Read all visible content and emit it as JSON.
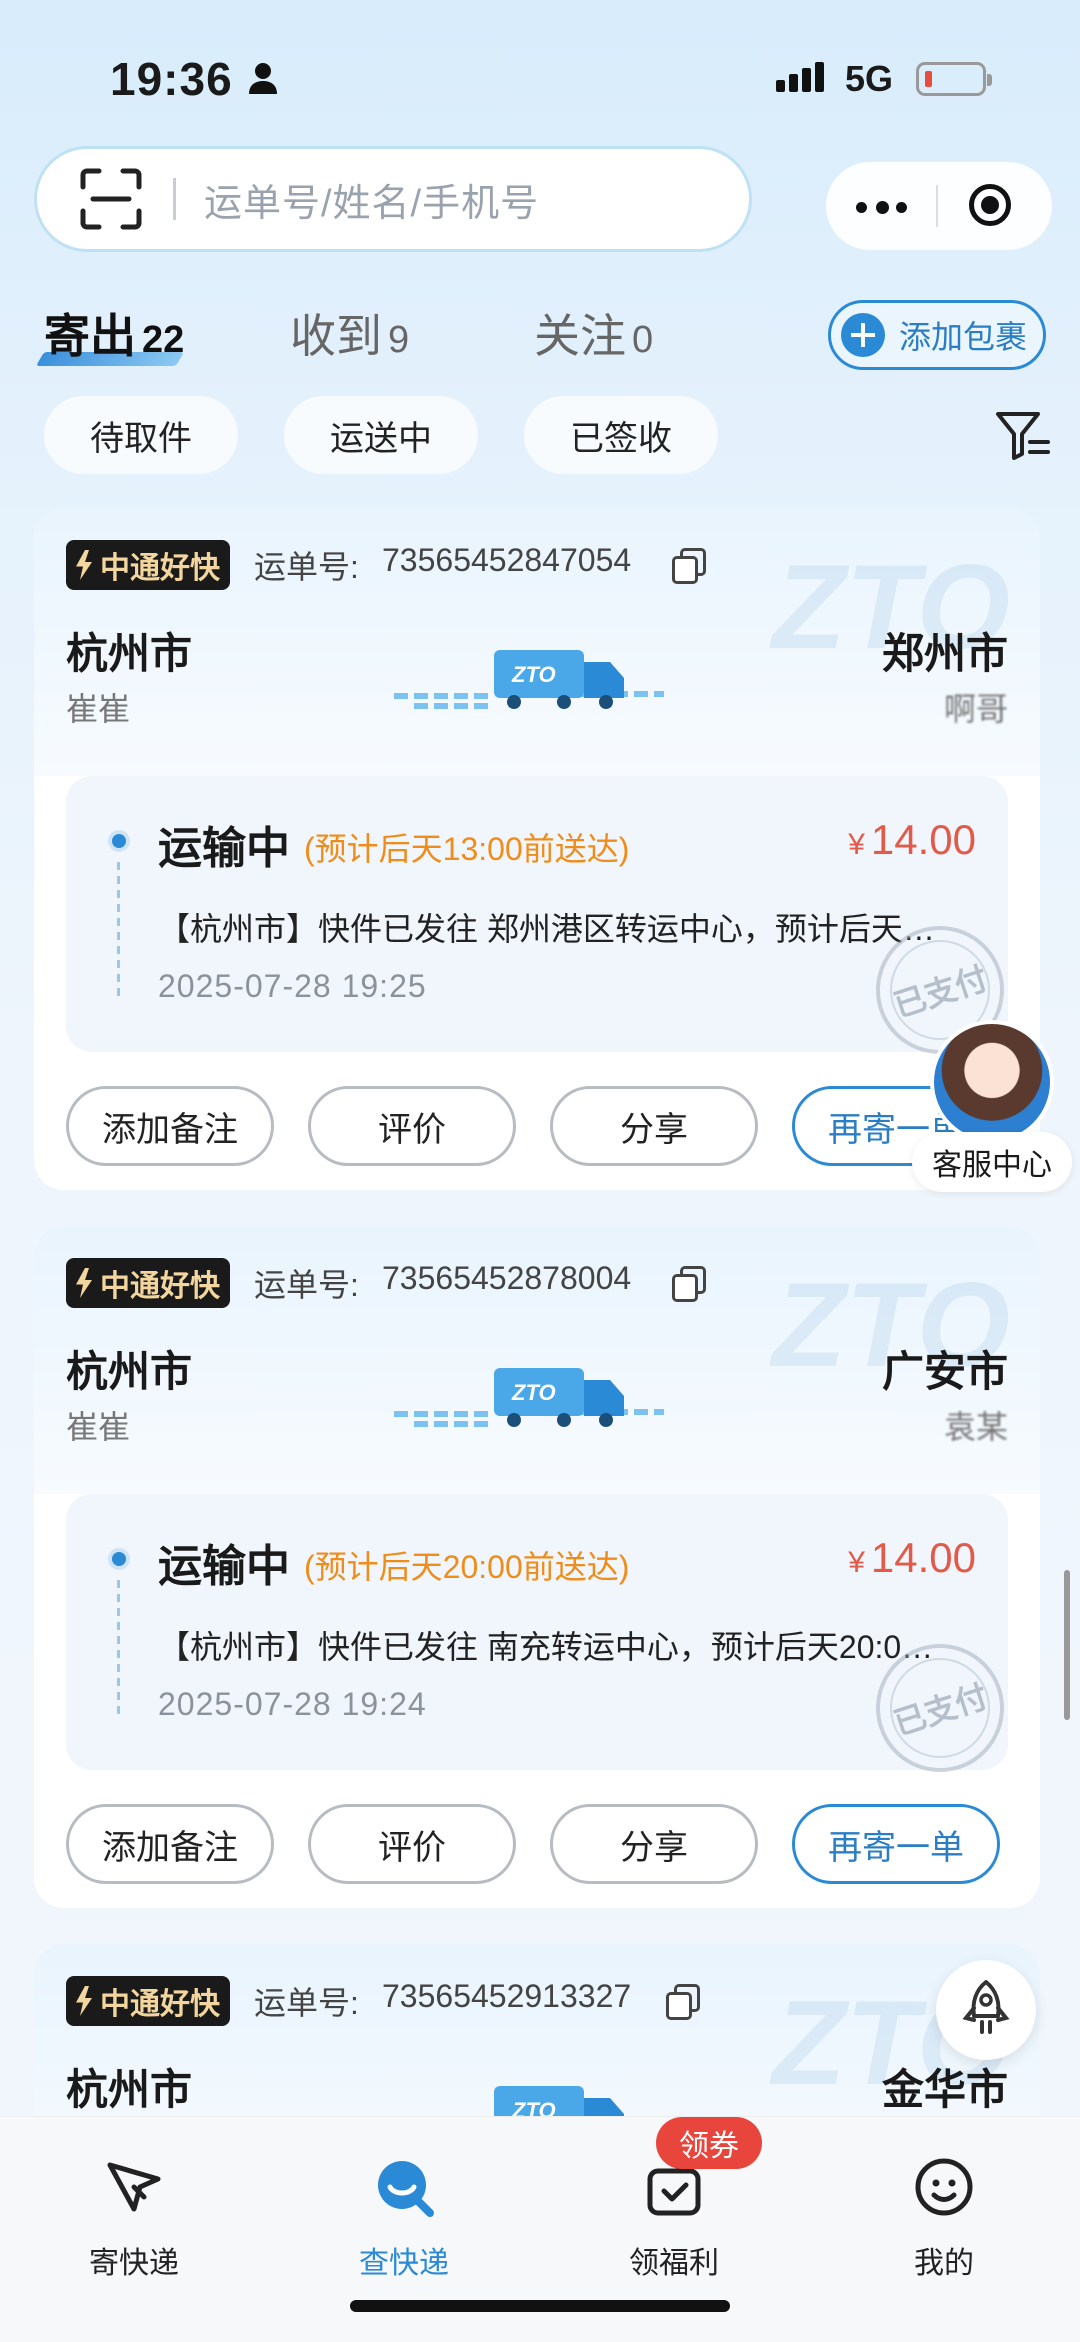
{
  "status_bar": {
    "time": "19:36",
    "network": "5G"
  },
  "search": {
    "placeholder": "运单号/姓名/手机号"
  },
  "tabs": [
    {
      "label": "寄出",
      "count": "22"
    },
    {
      "label": "收到",
      "count": "9"
    },
    {
      "label": "关注",
      "count": "0"
    }
  ],
  "add_package_label": "添加包裹",
  "filters": [
    "待取件",
    "运送中",
    "已签收"
  ],
  "waybill_label": "运单号:",
  "cards": [
    {
      "badge": "中通好快",
      "waybill": "73565452847054",
      "from_city": "杭州市",
      "from_name": "崔崔",
      "to_city": "郑州市",
      "to_name": "啊哥",
      "status": "运输中",
      "eta": "(预计后天13:00前送达)",
      "currency": "¥",
      "price": "14.00",
      "track": "【杭州市】快件已发往 郑州港区转运中心，预计后天…",
      "time": "2025-07-28 19:25",
      "stamp": "已支付",
      "actions": [
        "添加备注",
        "评价",
        "分享",
        "再寄一单"
      ]
    },
    {
      "badge": "中通好快",
      "waybill": "73565452878004",
      "from_city": "杭州市",
      "from_name": "崔崔",
      "to_city": "广安市",
      "to_name": "袁某",
      "status": "运输中",
      "eta": "(预计后天20:00前送达)",
      "currency": "¥",
      "price": "14.00",
      "track": "【杭州市】快件已发往 南充转运中心，预计后天20:0…",
      "time": "2025-07-28 19:24",
      "stamp": "已支付",
      "actions": [
        "添加备注",
        "评价",
        "分享",
        "再寄一单"
      ]
    },
    {
      "badge": "中通好快",
      "waybill": "73565452913327",
      "from_city": "杭州市",
      "to_city": "金华市"
    }
  ],
  "customer_service": "客服中心",
  "nav": [
    {
      "label": "寄快递",
      "icon": "send-icon"
    },
    {
      "label": "查快递",
      "icon": "search-package-icon"
    },
    {
      "label": "领福利",
      "icon": "gift-icon"
    },
    {
      "label": "我的",
      "icon": "profile-icon"
    }
  ],
  "coupon_badge": "领券",
  "colors": {
    "accent": "#2b8ad6",
    "price": "#e25a4a",
    "eta": "#f08c1a"
  }
}
